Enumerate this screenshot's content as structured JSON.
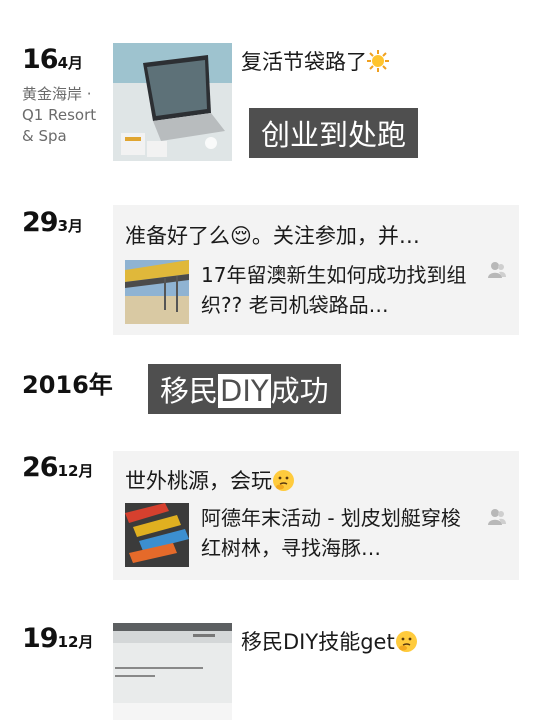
{
  "entries": [
    {
      "day": "16",
      "month": "4月",
      "location": "黄金海岸 · Q1 Resort & Spa",
      "text": "复活节袋路了",
      "emoji": "sun-emoji",
      "overlay": "创业到处跑"
    },
    {
      "day": "29",
      "month": "3月",
      "text": "准备好了么😌。关注参加，并…",
      "link_text": "17年留澳新生如何成功找到组织?? 老司机袋路品…"
    },
    {
      "year": "2016年",
      "overlay_before": "移民",
      "overlay_box": "DIY",
      "overlay_after": "成功"
    },
    {
      "day": "26",
      "month": "12月",
      "text": "世外桃源，会玩",
      "emoji": "thinking-face-emoji",
      "link_text": "阿德年末活动 - 划皮划艇穿梭红树林，寻找海豚…"
    },
    {
      "day": "19",
      "month": "12月",
      "text": "移民DIY技能get",
      "emoji": "thinking-face-emoji"
    }
  ],
  "colors": {
    "card_bg": "#f3f3f3",
    "overlay_bg": "#4f4f4f",
    "muted_text": "#6b6b6b"
  }
}
